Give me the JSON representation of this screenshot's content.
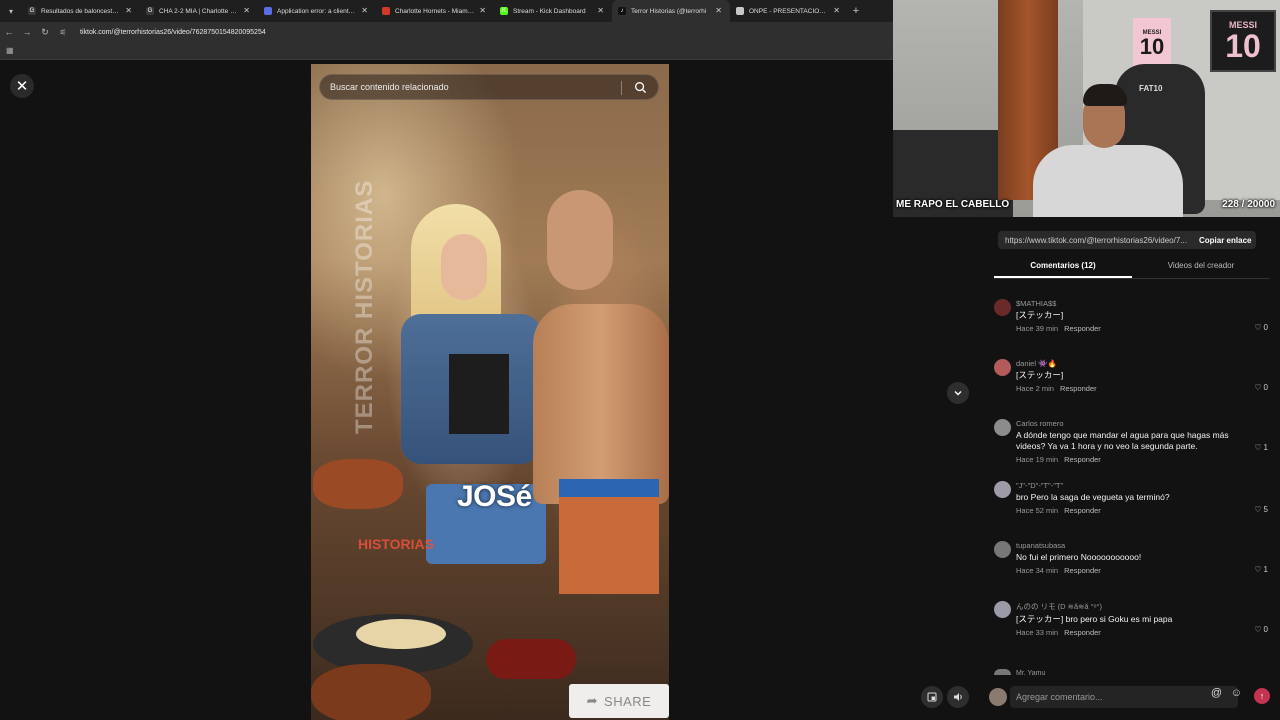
{
  "browser": {
    "tabs": [
      {
        "title": "Resultados de baloncesto en v",
        "fav_color": "#3a3a3a",
        "fav_glyph": "G"
      },
      {
        "title": "CHA 2-2 MIA | Charlotte Horne",
        "fav_color": "#3a3a3a",
        "fav_glyph": "G"
      },
      {
        "title": "Application error: a client-side",
        "fav_color": "#5b6ee1",
        "fav_glyph": ""
      },
      {
        "title": "Charlotte Hornets - Miami Hea",
        "fav_color": "#d33a2c",
        "fav_glyph": ""
      },
      {
        "title": "Stream - Kick Dashboard",
        "fav_color": "#53fc18",
        "fav_glyph": "K"
      },
      {
        "title": "Terror Historias (@terrorhi",
        "fav_color": "#111111",
        "fav_glyph": "♪",
        "active": true
      },
      {
        "title": "ONPE - PRESENTACIÓN DE RE",
        "fav_color": "#c8c8c8",
        "fav_glyph": ""
      }
    ],
    "new_tab": "+",
    "url": "tiktok.com/@terrorhistorias26/video/7628750154820095254"
  },
  "video": {
    "search_placeholder": "Buscar contenido relacionado",
    "watermark": "TERROR HISTORIAS",
    "logo_text": "HISTORIAS",
    "caption": "JOSé",
    "share_label": "SHARE"
  },
  "webcam": {
    "caption_left": "ME RAPO EL CABELLO",
    "caption_right": "228 / 20000",
    "poster_small_name": "MESSI",
    "poster_small_number": "10",
    "poster_large_name": "MESSI",
    "poster_large_number": "10",
    "chair_brand": "FAT10"
  },
  "panel": {
    "share_url": "https://www.tiktok.com/@terrorhistorias26/video/7...",
    "copy_label": "Copiar enlace",
    "tabs": [
      {
        "label": "Comentarios (12)",
        "active": true
      },
      {
        "label": "Videos del creador",
        "active": false
      }
    ],
    "reply_label": "Responder",
    "comments": [
      {
        "user": "$MATHIA$$",
        "text": "[ステッカー]",
        "time": "Hace 39 min",
        "likes": "0",
        "avatar_color": "#6b2a2a"
      },
      {
        "user": "daniel 👾🔥",
        "text": "[ステッカー]",
        "time": "Hace 2 min",
        "likes": "0",
        "avatar_color": "#b35a5a"
      },
      {
        "user": "Carlos romero",
        "text": "A dónde tengo que mandar el agua para que hagas más videos? Ya va 1 hora y no veo la segunda parte.",
        "time": "Hace 19 min",
        "likes": "1",
        "avatar_color": "#8c8c8c"
      },
      {
        "user": "\"J\"-\"D\"-\"T\"-\"T\"",
        "text": "bro Pero la saga de vegueta ya terminó?",
        "time": "Hace 52 min",
        "likes": "5",
        "avatar_color": "#a09aa8"
      },
      {
        "user": "tupanatsubasa",
        "text": "No fui el primero Nooooooooooo!",
        "time": "Hace 34 min",
        "likes": "1",
        "avatar_color": "#777777"
      },
      {
        "user": "んのの リモ (D ≋ǎ≋ǎ °ᵒ°)",
        "text": "[ステッカー] bro pero si Goku es mi papa",
        "time": "Hace 33 min",
        "likes": "0",
        "avatar_color": "#9a9aa8"
      }
    ],
    "partial_user": "Mr. Yamu",
    "compose_placeholder": "Agregar comentario...",
    "at_icon": "@",
    "emoji_icon": "☺"
  }
}
